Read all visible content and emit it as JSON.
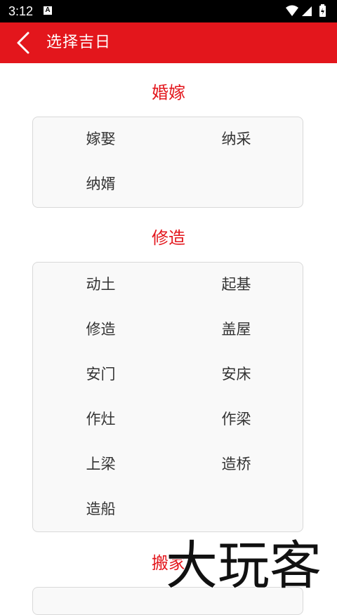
{
  "status_bar": {
    "time": "3:12",
    "notification_icon": "A",
    "icons": [
      "wifi-icon",
      "cellular-signal-icon",
      "battery-charging-icon"
    ]
  },
  "app_bar": {
    "back_icon": "chevron-left-icon",
    "title": "选择吉日"
  },
  "sections": [
    {
      "title": "婚嫁",
      "items": [
        "嫁娶",
        "纳采",
        "纳婿"
      ]
    },
    {
      "title": "修造",
      "items": [
        "动土",
        "起基",
        "修造",
        "盖屋",
        "安门",
        "安床",
        "作灶",
        "作梁",
        "上梁",
        "造桥",
        "造船"
      ]
    },
    {
      "title": "搬家",
      "items": []
    }
  ],
  "watermark": "大玩客",
  "colors": {
    "accent": "#e3161c",
    "card_bg": "#f9f9f9",
    "card_border": "#d9d9d9",
    "item_text": "#333333"
  }
}
